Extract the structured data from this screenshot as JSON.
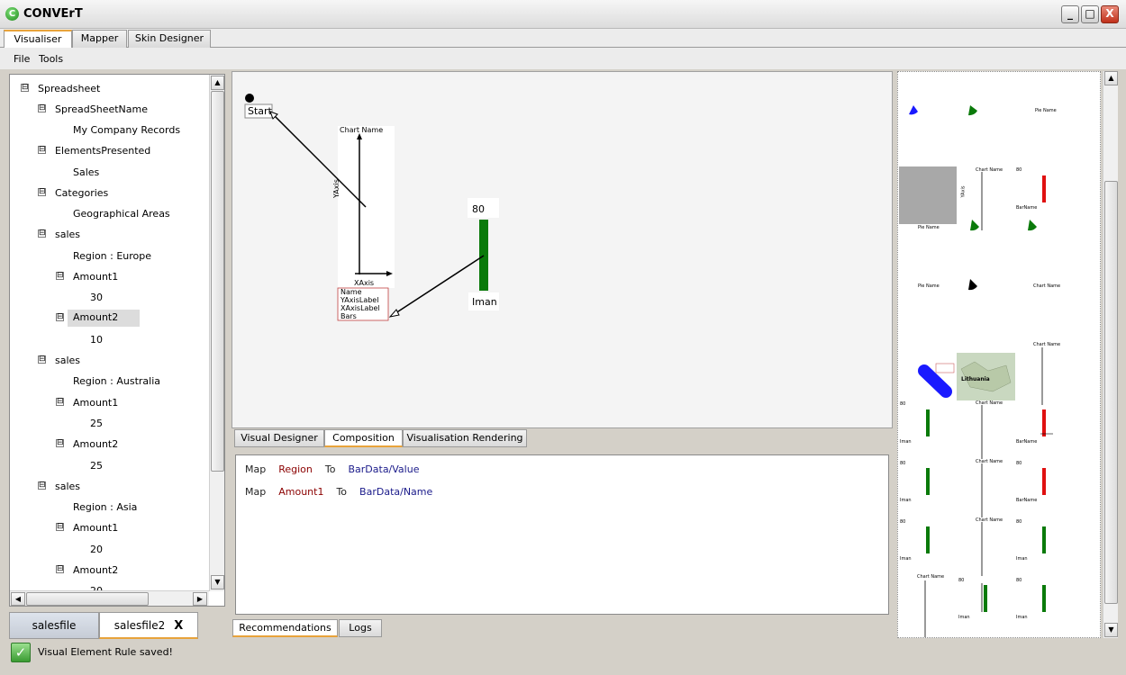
{
  "window": {
    "title": "CONVErT",
    "icon_letter": "C",
    "minimize": "_",
    "maximize": "□",
    "close": "X"
  },
  "top_tabs": [
    {
      "label": "Visualiser",
      "active": true
    },
    {
      "label": "Mapper",
      "active": false
    },
    {
      "label": "Skin Designer",
      "active": false
    }
  ],
  "menu": [
    "File",
    "Tools"
  ],
  "tree": [
    {
      "label": "Spreadsheet",
      "expander": "⊟"
    },
    {
      "label": "SpreadSheetName",
      "expander": "⊟"
    },
    {
      "label": "My Company Records",
      "expander": ""
    },
    {
      "label": "ElementsPresented",
      "expander": "⊟"
    },
    {
      "label": "Sales",
      "expander": ""
    },
    {
      "label": "Categories",
      "expander": "⊟"
    },
    {
      "label": "Geographical Areas",
      "expander": ""
    },
    {
      "label": "sales",
      "expander": "⊟"
    },
    {
      "label": "Region : Europe",
      "expander": ""
    },
    {
      "label": "Amount1",
      "expander": "⊟"
    },
    {
      "label": "30",
      "expander": ""
    },
    {
      "label": "Amount2",
      "expander": "⊟",
      "selected": true
    },
    {
      "label": "10",
      "expander": ""
    },
    {
      "label": "sales",
      "expander": "⊟"
    },
    {
      "label": "Region : Australia",
      "expander": ""
    },
    {
      "label": "Amount1",
      "expander": "⊟"
    },
    {
      "label": "25",
      "expander": ""
    },
    {
      "label": "Amount2",
      "expander": "⊟"
    },
    {
      "label": "25",
      "expander": ""
    },
    {
      "label": "sales",
      "expander": "⊟"
    },
    {
      "label": "Region : Asia",
      "expander": ""
    },
    {
      "label": "Amount1",
      "expander": "⊟"
    },
    {
      "label": "20",
      "expander": ""
    },
    {
      "label": "Amount2",
      "expander": "⊟"
    },
    {
      "label": "20",
      "expander": ""
    }
  ],
  "file_tabs": [
    {
      "label": "salesfile",
      "active": false
    },
    {
      "label": "salesfile2",
      "active": true,
      "close": "X"
    }
  ],
  "status": {
    "icon": "✓",
    "message": "Visual Element Rule saved!"
  },
  "canvas": {
    "start_label": "Start",
    "chart_title": "Chart Name",
    "yaxis_label": "YAxis",
    "xaxis_label": "XAxis",
    "chart_props": [
      "Name",
      "YAxisLabel",
      "XAxisLabel",
      "Bars"
    ],
    "bar_value": "80",
    "bar_name": "Iman",
    "bar_color": "#0a7a0a"
  },
  "middle_tabs": [
    {
      "label": "Visual Designer",
      "active": false
    },
    {
      "label": "Composition",
      "active": true
    },
    {
      "label": "Visualisation Rendering",
      "active": false
    }
  ],
  "composition_rules": [
    {
      "map": "Map",
      "source": "Region",
      "to": "To",
      "target": "BarData/Value"
    },
    {
      "map": "Map",
      "source": "Amount1",
      "to": "To",
      "target": "BarData/Name"
    }
  ],
  "bottom_tabs": [
    {
      "label": "Recommendations",
      "active": true
    },
    {
      "label": "Logs",
      "active": false
    }
  ],
  "preview": {
    "pie_name": "Pie Name",
    "chart_name": "Chart Name",
    "bar_name": "BarName",
    "yaxis": "YAxis",
    "label_80": "80",
    "iman": "Iman",
    "map_country": "Lithuania"
  }
}
